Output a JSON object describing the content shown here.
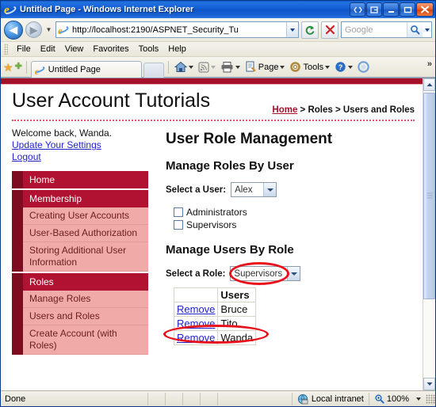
{
  "window": {
    "title": "Untitled Page - Windows Internet Explorer",
    "buttons": {
      "restore_group": "restore-down-group",
      "tab_list": "tab-list",
      "minimize": "minimize",
      "maximize": "maximize",
      "close": "close"
    }
  },
  "address_bar": {
    "url": "http://localhost:2190/ASPNET_Security_Tu",
    "back": "Back",
    "forward": "Forward",
    "refresh": "Refresh",
    "stop": "Stop",
    "search_placeholder": "Google"
  },
  "menu": {
    "items": [
      "File",
      "Edit",
      "View",
      "Favorites",
      "Tools",
      "Help"
    ]
  },
  "command_bar": {
    "tab_label": "Untitled Page",
    "buttons": [
      "Page",
      "Tools"
    ],
    "overflow": "»"
  },
  "page": {
    "site_title": "User Account Tutorials",
    "breadcrumb": {
      "home": "Home",
      "trail": " > Roles > Users and Roles"
    },
    "welcome": "Welcome back, Wanda.",
    "links": [
      "Update Your Settings",
      "Logout"
    ],
    "nav": [
      {
        "type": "section",
        "label": "Home"
      },
      {
        "type": "section",
        "label": "Membership"
      },
      {
        "type": "child",
        "label": "Creating User Accounts"
      },
      {
        "type": "child",
        "label": "User-Based Authorization"
      },
      {
        "type": "child",
        "label": "Storing Additional User Information"
      },
      {
        "type": "section",
        "label": "Roles"
      },
      {
        "type": "child",
        "label": "Manage Roles"
      },
      {
        "type": "child",
        "label": "Users and Roles"
      },
      {
        "type": "child",
        "label": "Create Account (with Roles)"
      }
    ],
    "main": {
      "heading": "User Role Management",
      "section_user": {
        "heading": "Manage Roles By User",
        "label": "Select a User:",
        "selected": "Alex",
        "checkboxes": [
          {
            "label": "Administrators",
            "checked": false
          },
          {
            "label": "Supervisors",
            "checked": false
          }
        ]
      },
      "section_role": {
        "heading": "Manage Users By Role",
        "label": "Select a Role:",
        "selected": "Supervisors",
        "table": {
          "headers": [
            "",
            "Users"
          ],
          "rows": [
            {
              "action": "Remove",
              "user": "Bruce"
            },
            {
              "action": "Remove",
              "user": "Tito"
            },
            {
              "action": "Remove",
              "user": "Wanda"
            }
          ]
        }
      }
    }
  },
  "status_bar": {
    "status": "Done",
    "zone": "Local intranet",
    "zoom": "100%"
  },
  "colors": {
    "brand_red": "#a5112b",
    "nav_section": "#b21231",
    "nav_section_tab": "#7d0c20",
    "nav_child": "#f0aaa8",
    "annotation_red": "#e8111b",
    "link_blue": "#2222cc",
    "title_blue": "#1560d8"
  }
}
